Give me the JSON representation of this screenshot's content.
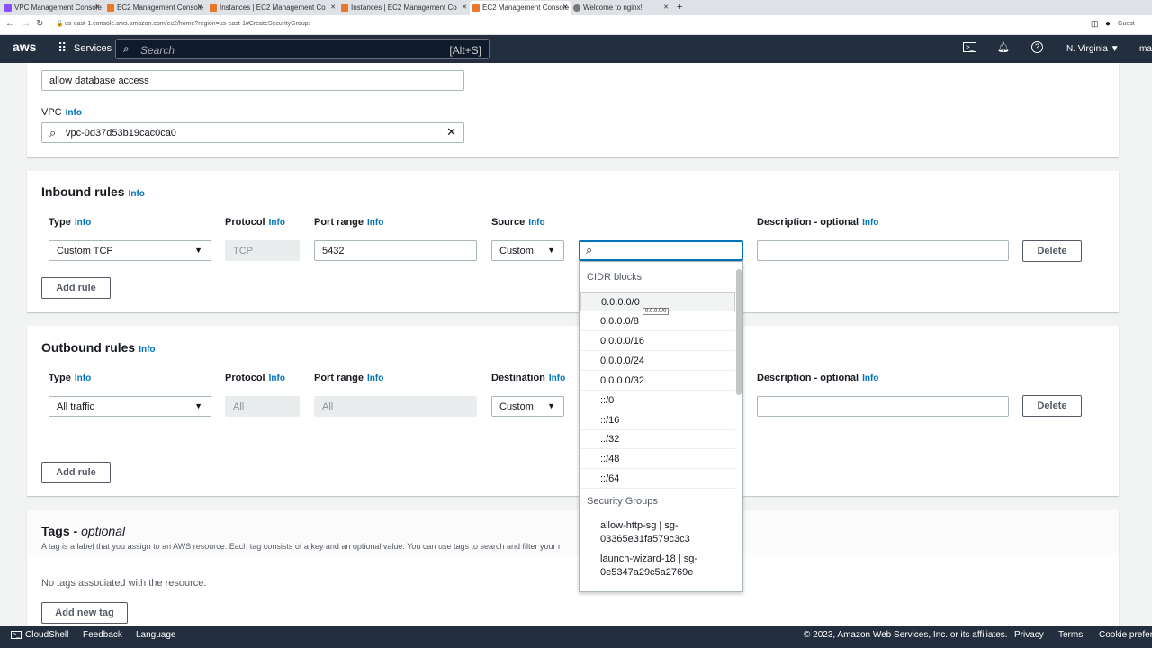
{
  "browser": {
    "tabs": [
      "VPC Management Console",
      "EC2 Management Console",
      "Instances | EC2 Management Co",
      "Instances | EC2 Management Co",
      "EC2 Management Console",
      "Welcome to nginx!"
    ],
    "url": "us-east-1.console.aws.amazon.com/ec2/home?region=us-east-1#CreateSecurityGroup:",
    "profile": "Guest"
  },
  "nav": {
    "logo": "aws",
    "services": "Services",
    "search_placeholder": "Search",
    "search_shortcut": "[Alt+S]",
    "region": "N. Virginia",
    "user": "ma"
  },
  "basic": {
    "description_value": "allow database access",
    "vpc_label": "VPC",
    "info": "Info",
    "vpc_value": "vpc-0d37d53b19cac0ca0"
  },
  "inbound": {
    "title": "Inbound rules",
    "info": "Info",
    "cols": {
      "type": "Type",
      "protocol": "Protocol",
      "port": "Port range",
      "source": "Source",
      "desc": "Description - optional"
    },
    "row": {
      "type": "Custom TCP",
      "protocol": "TCP",
      "port": "5432",
      "source": "Custom",
      "search": "",
      "desc": ""
    },
    "delete": "Delete",
    "add_rule": "Add rule"
  },
  "outbound": {
    "title": "Outbound rules",
    "info": "Info",
    "cols": {
      "type": "Type",
      "protocol": "Protocol",
      "port": "Port range",
      "dest": "Destination",
      "desc": "Description - optional"
    },
    "row": {
      "type": "All traffic",
      "protocol": "All",
      "port": "All",
      "dest": "Custom",
      "desc": ""
    },
    "delete": "Delete",
    "add_rule": "Add rule"
  },
  "dropdown": {
    "cidr_header": "CIDR blocks",
    "cidr": [
      "0.0.0.0/0",
      "0.0.0.0/8",
      "0.0.0.0/16",
      "0.0.0.0/24",
      "0.0.0.0/32",
      "::/0",
      "::/16",
      "::/32",
      "::/48",
      "::/64"
    ],
    "tooltip": "0.0.0.0/0",
    "sg_header": "Security Groups",
    "sgs": [
      {
        "l1": "allow-http-sg | sg-",
        "l2": "03365e31fa579c3c3"
      },
      {
        "l1": "launch-wizard-18 | sg-",
        "l2": "0e5347a29c5a2769e"
      }
    ]
  },
  "tags": {
    "title": "Tags - ",
    "title_em": "optional",
    "desc": "A tag is a label that you assign to an AWS resource. Each tag consists of a key and an optional value. You can use tags to search and filter your r",
    "empty": "No tags associated with the resource.",
    "add": "Add new tag"
  },
  "footer": {
    "cloudshell": "CloudShell",
    "feedback": "Feedback",
    "language": "Language",
    "copyright": "© 2023, Amazon Web Services, Inc. or its affiliates.",
    "privacy": "Privacy",
    "terms": "Terms",
    "cookie": "Cookie prefere"
  }
}
